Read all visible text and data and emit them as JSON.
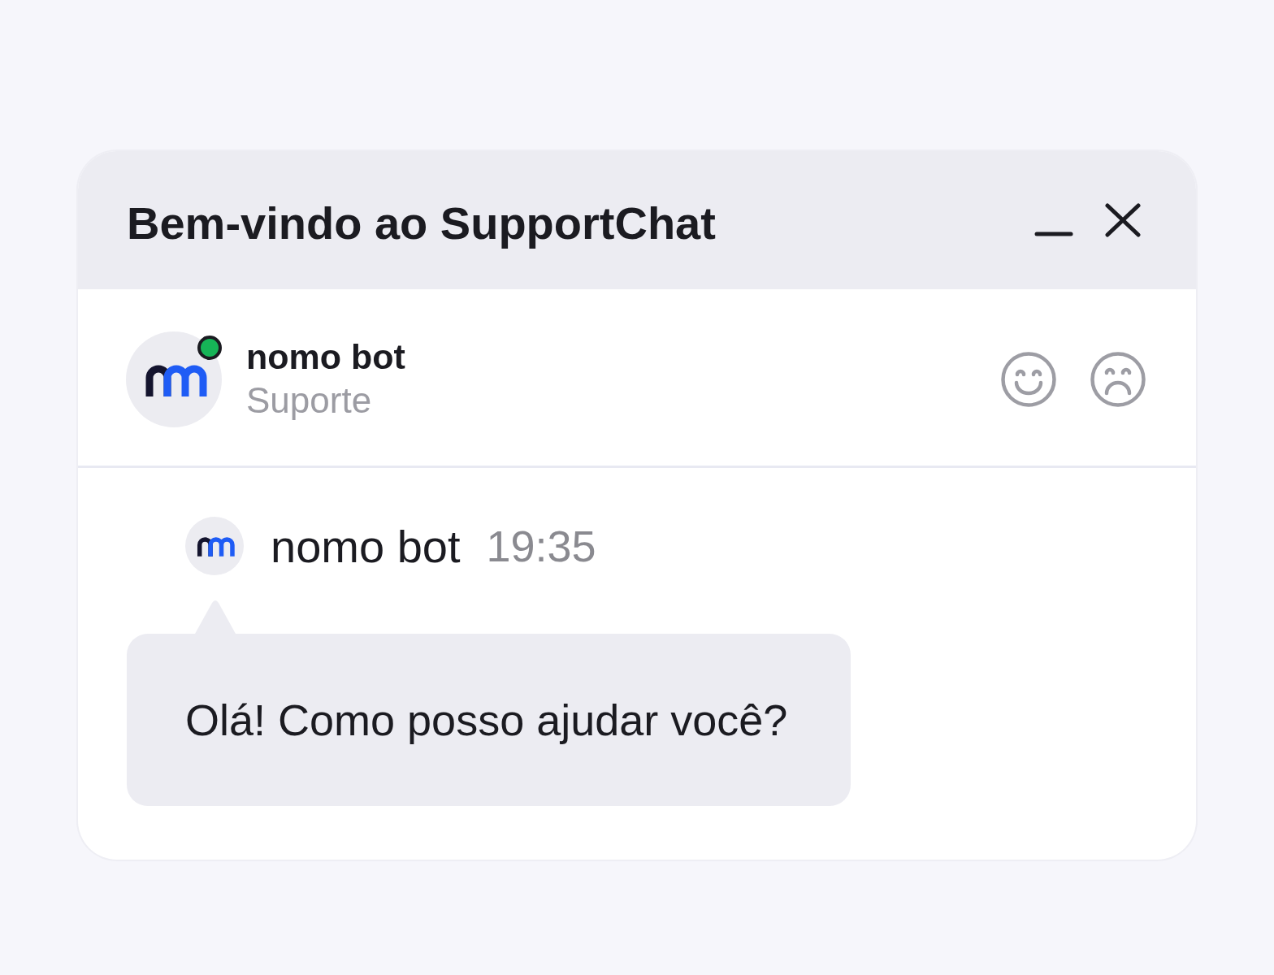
{
  "window": {
    "title": "Bem-vindo ao SupportChat"
  },
  "agent": {
    "name": "nomo bot",
    "role": "Suporte",
    "online": true
  },
  "messages": [
    {
      "sender": "nomo bot",
      "time": "19:35",
      "text": "Olá! Como posso ajudar você?"
    }
  ]
}
